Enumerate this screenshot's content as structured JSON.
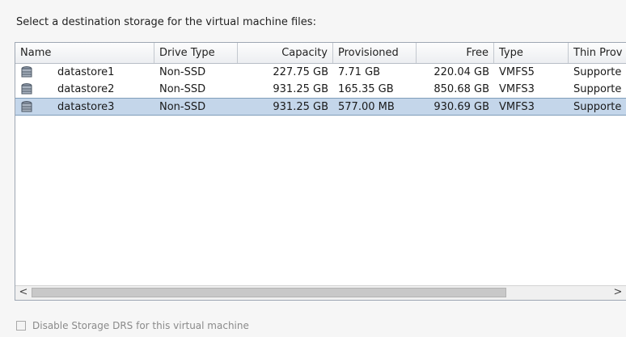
{
  "instruction": "Select a destination storage for the virtual machine files:",
  "table": {
    "columns": [
      "Name",
      "Drive Type",
      "Capacity",
      "Provisioned",
      "Free",
      "Type",
      "Thin Prov"
    ],
    "rows": [
      {
        "name": "datastore1",
        "drive_type": "Non-SSD",
        "capacity": "227.75 GB",
        "provisioned": "7.71 GB",
        "free": "220.04 GB",
        "type": "VMFS5",
        "thin": "Supporte",
        "selected": false
      },
      {
        "name": "datastore2",
        "drive_type": "Non-SSD",
        "capacity": "931.25 GB",
        "provisioned": "165.35 GB",
        "free": "850.68 GB",
        "type": "VMFS3",
        "thin": "Supporte",
        "selected": false
      },
      {
        "name": "datastore3",
        "drive_type": "Non-SSD",
        "capacity": "931.25 GB",
        "provisioned": "577.00 MB",
        "free": "930.69 GB",
        "type": "VMFS3",
        "thin": "Supporte",
        "selected": true
      }
    ]
  },
  "scrollbar": {
    "left_arrow": "<",
    "right_arrow": ">"
  },
  "options": {
    "disable_sdrs_label": "Disable Storage DRS for this virtual machine",
    "disable_sdrs_checked": false
  },
  "icons": {
    "datastore": "datastore-icon"
  }
}
